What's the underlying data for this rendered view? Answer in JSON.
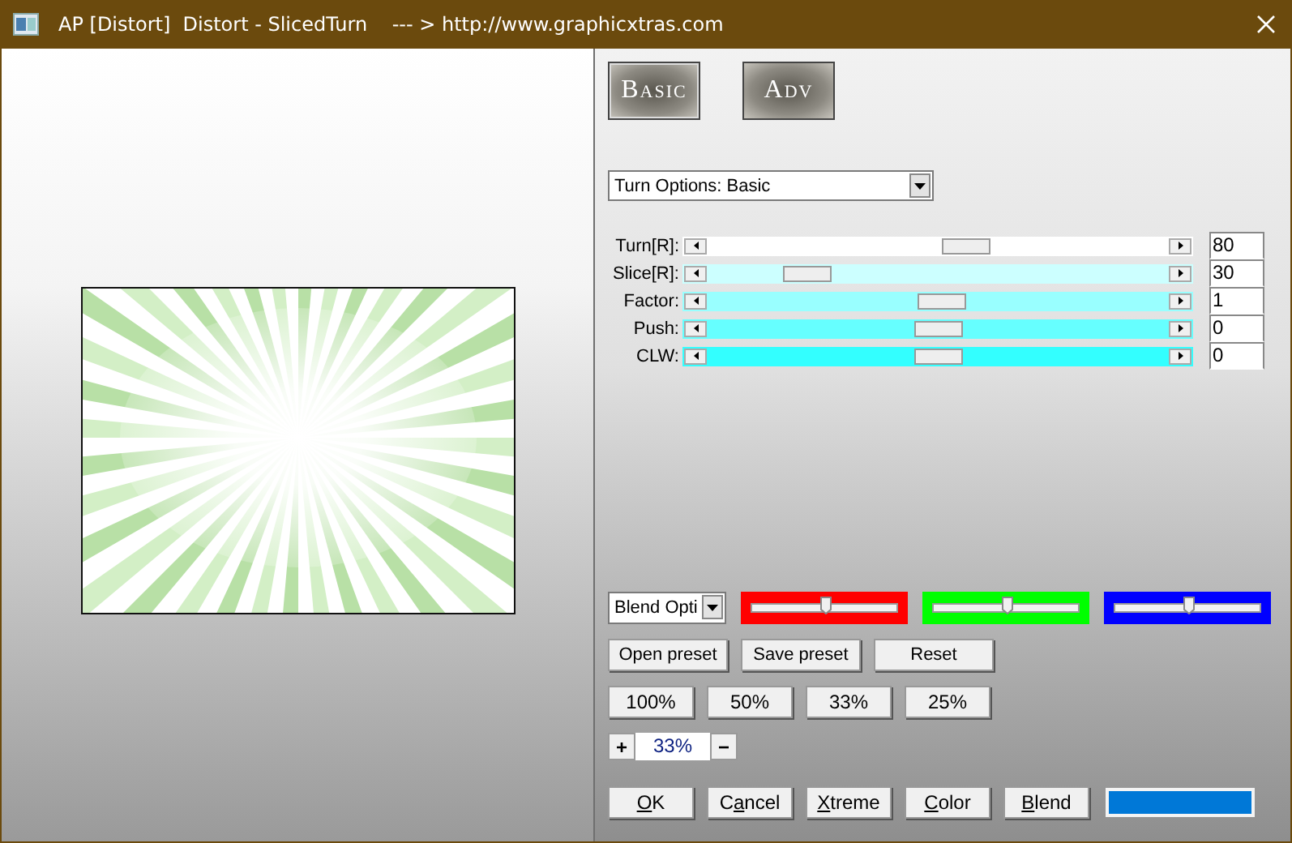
{
  "window": {
    "title": "AP [Distort]  Distort - SlicedTurn    --- > http://www.graphicxtras.com"
  },
  "mode_buttons": [
    {
      "label": "Basic",
      "selected": true
    },
    {
      "label": "Adv",
      "selected": false
    }
  ],
  "options_dropdown": {
    "value": "Turn Options: Basic"
  },
  "sliders": [
    {
      "label": "Turn[R]:",
      "level": 0.57,
      "color": "#ffffff",
      "value": "80"
    },
    {
      "label": "Slice[R]:",
      "level": 0.18,
      "color": "#ccffff",
      "value": "30"
    },
    {
      "label": "Factor:",
      "level": 0.51,
      "color": "#99ffff",
      "value": "1"
    },
    {
      "label": "Push:",
      "level": 0.5,
      "color": "#66ffff",
      "value": "0"
    },
    {
      "label": "CLW:",
      "level": 0.5,
      "color": "#33ffff",
      "value": "0"
    }
  ],
  "blend_dropdown": {
    "value": "Blend Opti"
  },
  "color_sliders": [
    {
      "color": "#ff0000",
      "level": 0.5
    },
    {
      "color": "#00ff00",
      "level": 0.5
    },
    {
      "color": "#0000ff",
      "level": 0.5
    }
  ],
  "preset_buttons": [
    "Open preset",
    "Save preset",
    "Reset"
  ],
  "zoom_buttons": [
    "100%",
    "50%",
    "33%",
    "25%"
  ],
  "zoom_stepper": {
    "plus": "+",
    "value": "33%",
    "minus": "−"
  },
  "action_buttons": [
    {
      "key": "O",
      "rest": "K"
    },
    {
      "lead": "C",
      "key": "a",
      "rest": "ncel"
    },
    {
      "key": "X",
      "rest": "treme"
    },
    {
      "key": "C",
      "rest": "olor"
    },
    {
      "key": "B",
      "rest": "lend"
    }
  ],
  "color_swatch": {
    "color": "#0078d7"
  }
}
